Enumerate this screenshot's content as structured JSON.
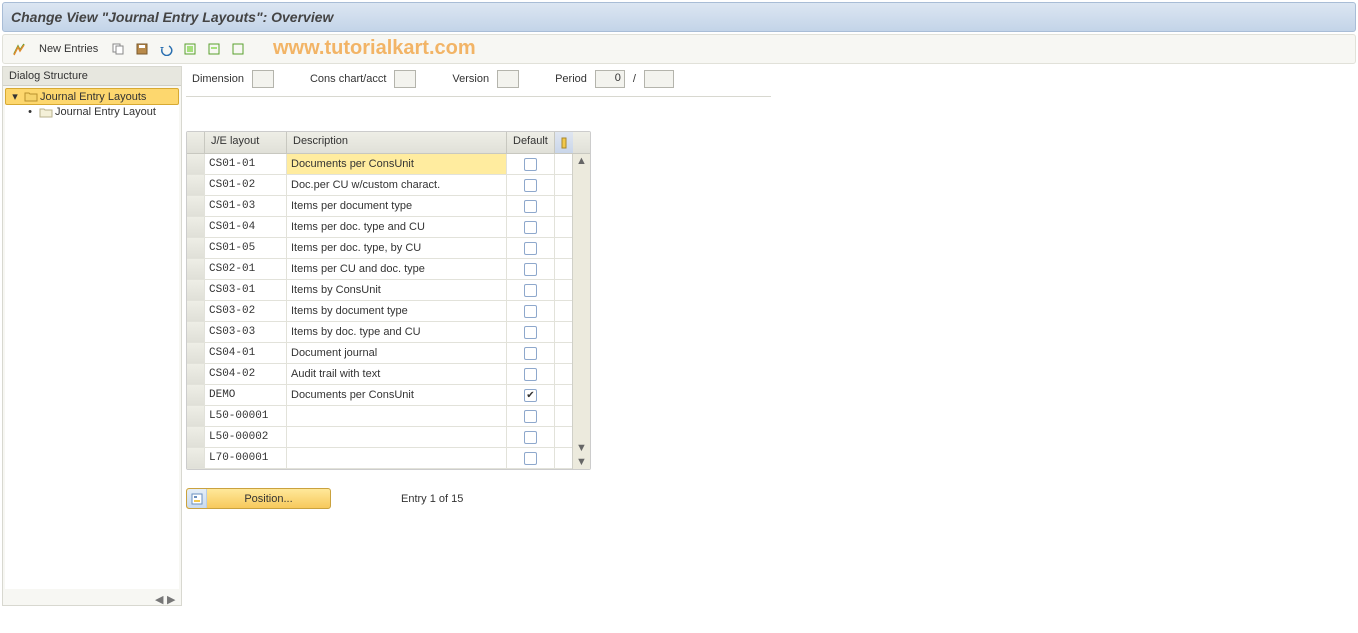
{
  "title": "Change View \"Journal Entry Layouts\": Overview",
  "toolbar": {
    "new_entries_label": "New Entries"
  },
  "watermark": "www.tutorialkart.com",
  "tree": {
    "header": "Dialog Structure",
    "items": [
      {
        "label": "Journal Entry Layouts",
        "selected": true,
        "icon": "folder-open"
      },
      {
        "label": "Journal Entry Layout",
        "selected": false,
        "icon": "folder"
      }
    ]
  },
  "filters": {
    "dimension_label": "Dimension",
    "cons_label": "Cons chart/acct",
    "version_label": "Version",
    "period_label": "Period",
    "period_value": "0",
    "period_sep": "/"
  },
  "table": {
    "columns": {
      "layout": "J/E layout",
      "description": "Description",
      "default": "Default"
    },
    "rows": [
      {
        "layout": "CS01-01",
        "desc": "Documents per ConsUnit",
        "checked": false,
        "highlight": true
      },
      {
        "layout": "CS01-02",
        "desc": "Doc.per CU w/custom charact.",
        "checked": false
      },
      {
        "layout": "CS01-03",
        "desc": "Items per document type",
        "checked": false
      },
      {
        "layout": "CS01-04",
        "desc": "Items per doc. type and CU",
        "checked": false
      },
      {
        "layout": "CS01-05",
        "desc": "Items per doc. type, by CU",
        "checked": false
      },
      {
        "layout": "CS02-01",
        "desc": "Items per CU and doc. type",
        "checked": false
      },
      {
        "layout": "CS03-01",
        "desc": "Items by ConsUnit",
        "checked": false
      },
      {
        "layout": "CS03-02",
        "desc": "Items by document type",
        "checked": false
      },
      {
        "layout": "CS03-03",
        "desc": "Items by doc. type and CU",
        "checked": false
      },
      {
        "layout": "CS04-01",
        "desc": "Document journal",
        "checked": false
      },
      {
        "layout": "CS04-02",
        "desc": "Audit trail with text",
        "checked": false
      },
      {
        "layout": "DEMO",
        "desc": "Documents per ConsUnit",
        "checked": true
      },
      {
        "layout": "L50-00001",
        "desc": "",
        "checked": false
      },
      {
        "layout": "L50-00002",
        "desc": "",
        "checked": false
      },
      {
        "layout": "L70-00001",
        "desc": "",
        "checked": false
      }
    ]
  },
  "footer": {
    "position_label": "Position...",
    "entry_text": "Entry 1 of 15"
  }
}
